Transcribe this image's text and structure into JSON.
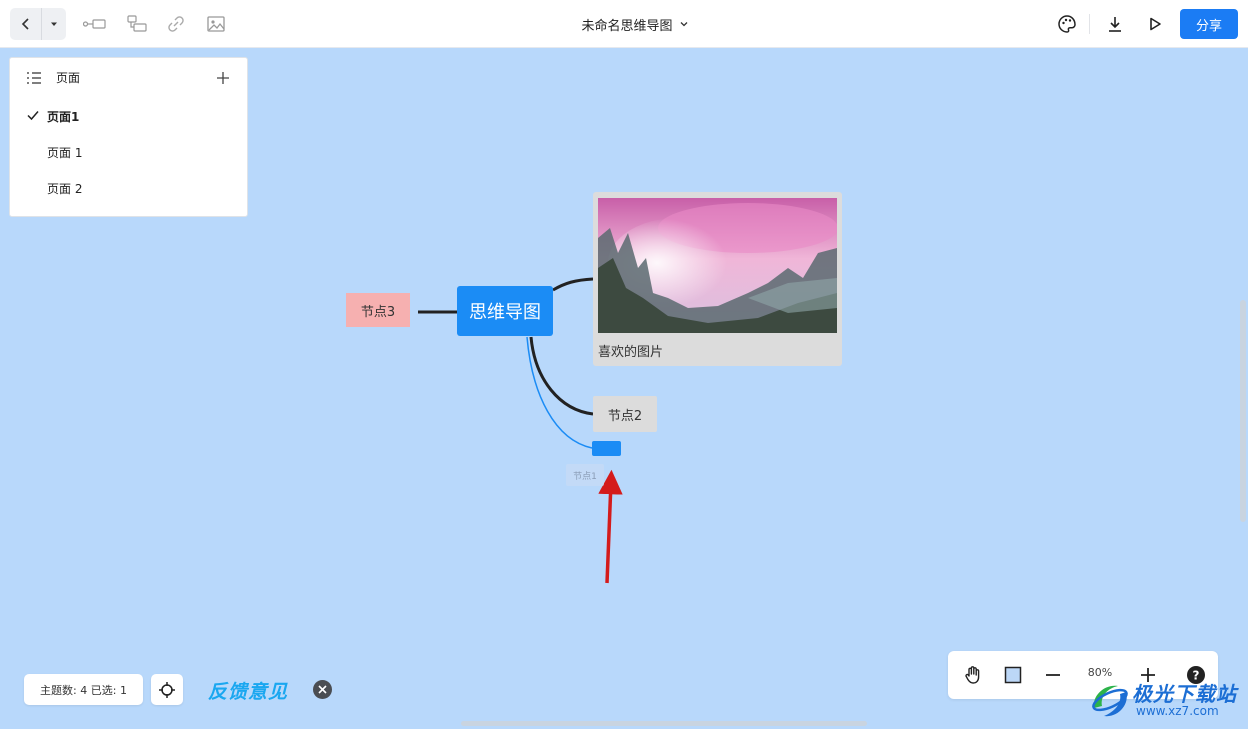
{
  "topbar": {
    "title": "未命名思维导图",
    "share_label": "分享"
  },
  "pages_panel": {
    "title": "页面",
    "items": [
      {
        "label": "页面1",
        "active": true
      },
      {
        "label": "页面 1",
        "active": false
      },
      {
        "label": "页面 2",
        "active": false
      }
    ]
  },
  "mindmap": {
    "root": "思维导图",
    "node3": "节点3",
    "node2": "节点2",
    "image_caption": "喜欢的图片",
    "ghost_label": "节点1"
  },
  "status": {
    "text": "主题数: 4 已选: 1"
  },
  "feedback_label": "反馈意见",
  "zoom": {
    "level": "80%"
  },
  "watermark": {
    "name": "极光下载站",
    "url": "www.xz7.com"
  },
  "colors": {
    "canvas": "#b8d8fb",
    "accent": "#1b7cf4",
    "node3_bg": "#f6b0b0",
    "arrow": "#d41b1b"
  }
}
